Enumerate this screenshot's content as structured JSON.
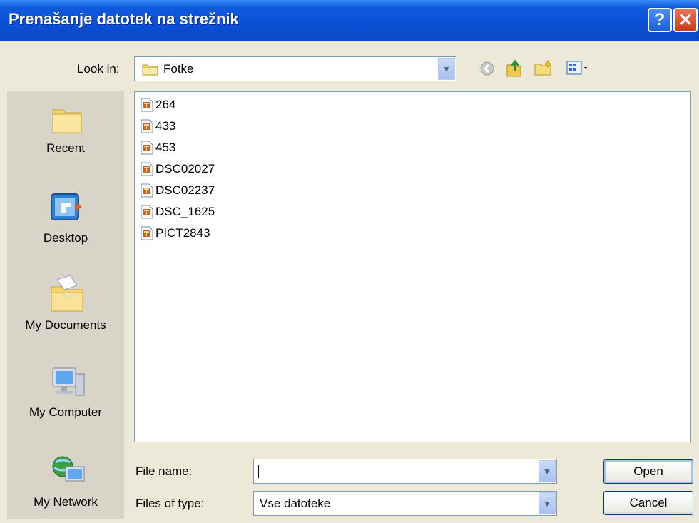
{
  "window": {
    "title": "Prenašanje datotek na strežnik",
    "help_label": "?",
    "close_label": "✕"
  },
  "lookin": {
    "label": "Look in:",
    "value": "Fotke"
  },
  "places": [
    {
      "label": "Recent",
      "icon": "recent-folder-icon"
    },
    {
      "label": "Desktop",
      "icon": "desktop-icon"
    },
    {
      "label": "My Documents",
      "icon": "my-documents-icon"
    },
    {
      "label": "My Computer",
      "icon": "my-computer-icon"
    },
    {
      "label": "My Network",
      "icon": "my-network-icon"
    }
  ],
  "files": [
    "264",
    "433",
    "453",
    "DSC02027",
    "DSC02237",
    "DSC_1625",
    "PICT2843"
  ],
  "filename": {
    "label": "File name:",
    "value": ""
  },
  "filetype": {
    "label": "Files of type:",
    "value": "Vse datoteke"
  },
  "buttons": {
    "open": "Open",
    "cancel": "Cancel"
  },
  "toolbar_icons": [
    "back-icon",
    "up-folder-icon",
    "new-folder-icon",
    "views-menu-icon"
  ],
  "colors": {
    "titlebar": "#0A4FD6",
    "dialog_bg": "#ECE9D8",
    "places_bg": "#D8D5C8",
    "close": "#C93A1C"
  }
}
